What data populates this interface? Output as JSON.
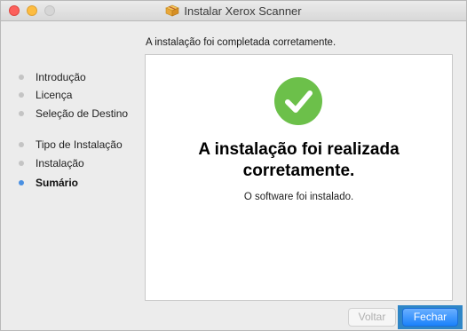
{
  "window": {
    "title": "Instalar Xerox Scanner"
  },
  "step_header": "A instalação foi completada corretamente.",
  "sidebar": {
    "items": [
      {
        "label": "Introdução",
        "current": false
      },
      {
        "label": "Licença",
        "current": false
      },
      {
        "label": "Seleção de Destino",
        "current": false
      },
      {
        "label": "Tipo de Instalação",
        "current": false
      },
      {
        "label": "Instalação",
        "current": false
      },
      {
        "label": "Sumário",
        "current": true
      }
    ]
  },
  "main": {
    "headline_line1": "A instalação foi realizada",
    "headline_line2": "corretamente.",
    "subtext": "O software foi instalado.",
    "success_icon": "checkmark-circle-icon"
  },
  "buttons": {
    "back_label": "Voltar",
    "close_label": "Fechar"
  },
  "colors": {
    "success": "#6cc04a",
    "accent": "#1a82fb",
    "current_step": "#4a90e2"
  }
}
